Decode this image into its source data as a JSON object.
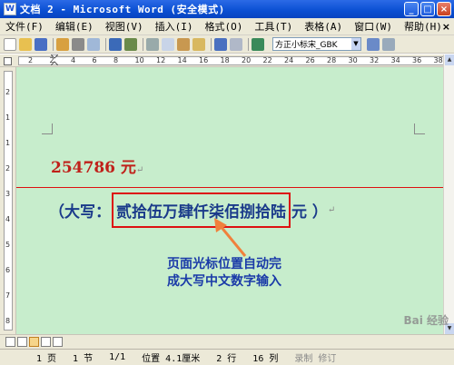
{
  "window": {
    "title": "文档 2 - Microsoft Word (安全模式)",
    "app_icon_letter": "W",
    "minimize": "_",
    "maximize": "□",
    "close": "×"
  },
  "menu": {
    "items": [
      "文件(F)",
      "编辑(E)",
      "视图(V)",
      "插入(I)",
      "格式(O)",
      "工具(T)",
      "表格(A)",
      "窗口(W)",
      "帮助(H)"
    ],
    "close_glyph": "×"
  },
  "toolbar": {
    "font_name": "方正小标宋_GBK"
  },
  "ruler": {
    "h_numbers": [
      "2",
      "2",
      "4",
      "6",
      "8",
      "10",
      "12",
      "14",
      "16",
      "18",
      "20",
      "22",
      "24",
      "26",
      "28",
      "30",
      "32",
      "34",
      "36",
      "38"
    ],
    "v_numbers": [
      "2",
      "1",
      "1",
      "2",
      "3",
      "4",
      "5",
      "6",
      "7",
      "8"
    ]
  },
  "document": {
    "amount_text": "254786 元",
    "caps_open": "（大写：",
    "caps_value": "贰拾伍万肆仟柒佰捌拾陆",
    "caps_close": "元 ）",
    "para_mark": "↵",
    "annotation_line1": "页面光标位置自动完",
    "annotation_line2": "成大写中文数字输入"
  },
  "status": {
    "page": "1 页",
    "section": "1 节",
    "page_of": "1/1",
    "position": "位置 4.1厘米",
    "line": "2 行",
    "column": "16 列",
    "rec": "录制",
    "trk": "修订"
  },
  "watermark": "Bai 经验",
  "colors": {
    "doc_bg": "#c7edcc",
    "amount": "#c0201a",
    "caps_text": "#1a3a8a",
    "highlight_box": "#dd1111",
    "annotation": "#1a3aa8"
  }
}
